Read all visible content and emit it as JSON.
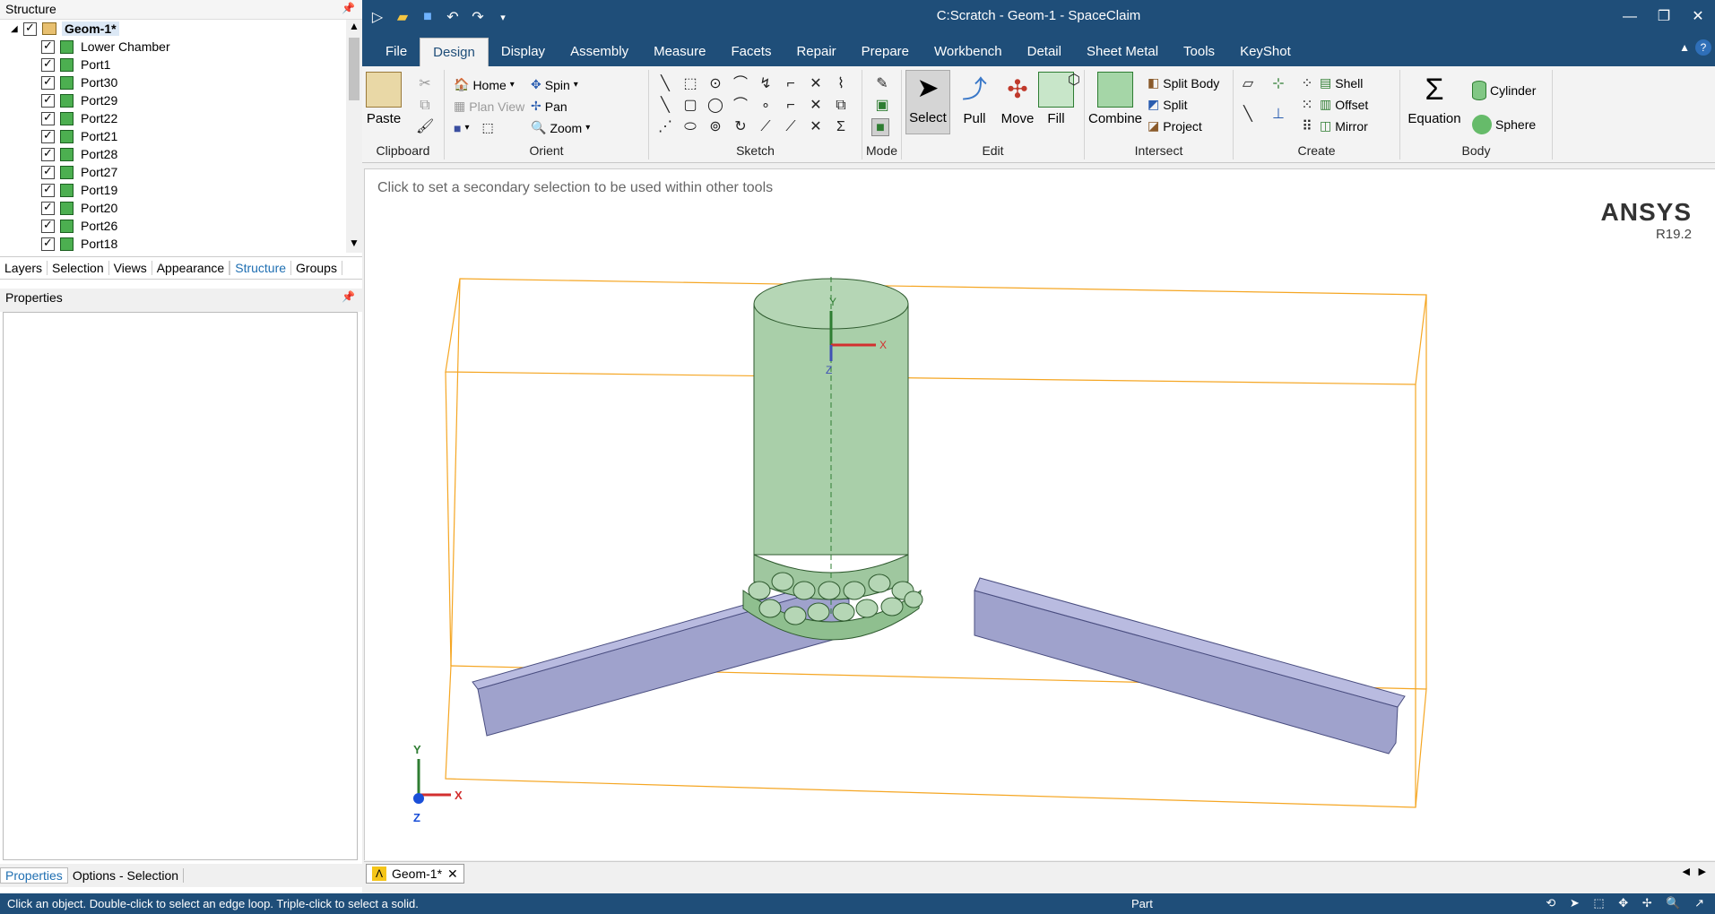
{
  "window": {
    "title": "C:Scratch - Geom-1 - SpaceClaim"
  },
  "qat_icons": [
    "spaceclaim-logo-icon",
    "open-icon",
    "save-icon",
    "undo-icon",
    "redo-icon",
    "customize-icon"
  ],
  "ribbon_tabs": [
    "File",
    "Design",
    "Display",
    "Assembly",
    "Measure",
    "Facets",
    "Repair",
    "Prepare",
    "Workbench",
    "Detail",
    "Sheet Metal",
    "Tools",
    "KeyShot"
  ],
  "active_tab": "Design",
  "ribbon": {
    "clipboard": {
      "label": "Clipboard",
      "paste": "Paste"
    },
    "orient": {
      "label": "Orient",
      "home": "Home",
      "plan_view": "Plan View",
      "spin": "Spin",
      "pan": "Pan",
      "zoom": "Zoom"
    },
    "sketch": {
      "label": "Sketch"
    },
    "mode": {
      "label": "Mode"
    },
    "edit": {
      "label": "Edit",
      "select": "Select",
      "pull": "Pull",
      "move": "Move",
      "fill": "Fill"
    },
    "intersect": {
      "label": "Intersect",
      "combine": "Combine",
      "split_body": "Split Body",
      "split": "Split",
      "project": "Project"
    },
    "create": {
      "label": "Create",
      "shell": "Shell",
      "offset": "Offset",
      "mirror": "Mirror"
    },
    "body": {
      "label": "Body",
      "equation": "Equation",
      "cylinder": "Cylinder",
      "sphere": "Sphere"
    }
  },
  "structure": {
    "title": "Structure",
    "root": "Geom-1*",
    "items": [
      "Lower Chamber",
      "Port1",
      "Port30",
      "Port29",
      "Port22",
      "Port21",
      "Port28",
      "Port27",
      "Port19",
      "Port20",
      "Port26",
      "Port18"
    ]
  },
  "panel_tabs": [
    "Layers",
    "Selection",
    "Views",
    "Appearance",
    "Structure",
    "Groups"
  ],
  "properties": {
    "title": "Properties"
  },
  "bottom_panel_tabs": [
    "Properties",
    "Options - Selection"
  ],
  "viewport": {
    "hint": "Click to set a secondary selection to be used within other tools",
    "brand": "ANSYS",
    "version": "R19.2",
    "axis_x": "X",
    "axis_y": "Y",
    "axis_z": "Z"
  },
  "document_tab": "Geom-1*",
  "status": {
    "message": "Click an object. Double-click to select an edge loop. Triple-click to select a solid.",
    "mode": "Part"
  }
}
